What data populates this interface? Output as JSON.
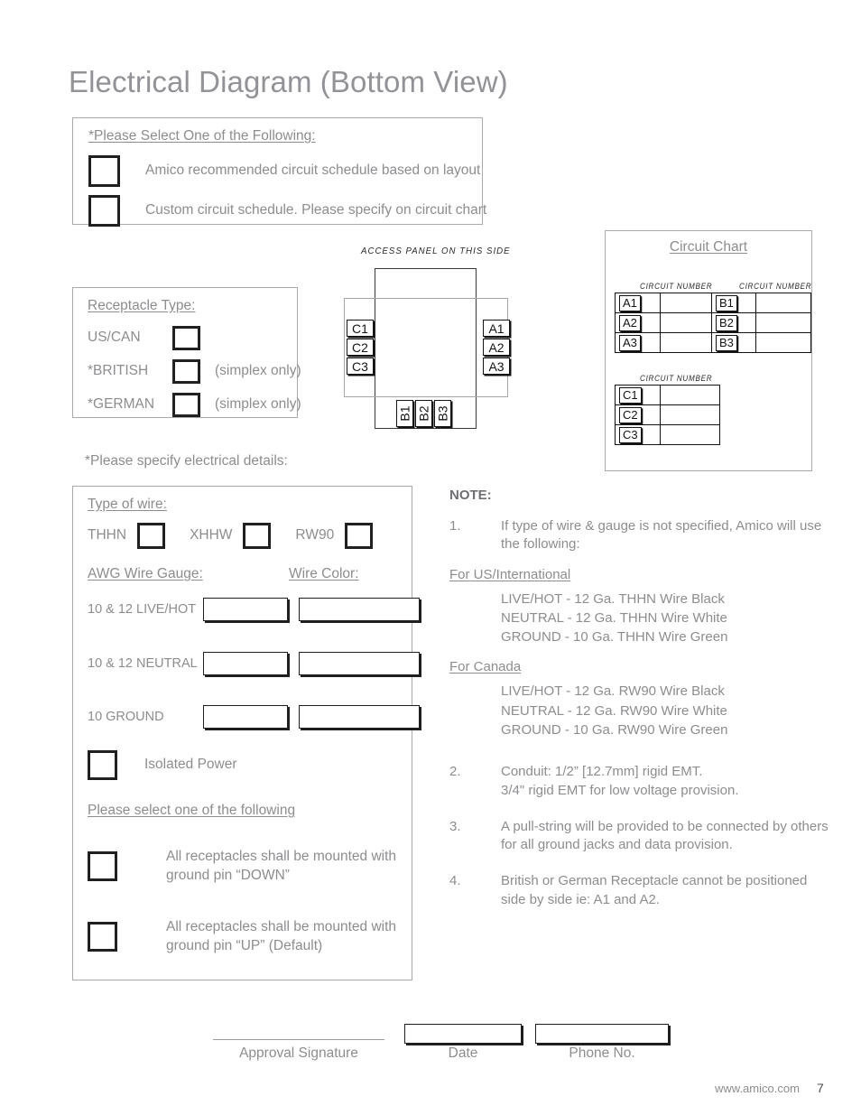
{
  "page_title": "Electrical Diagram (Bottom View)",
  "select_one": {
    "title": "*Please Select One of the Following:",
    "options": [
      "Amico recommended circuit schedule based on layout",
      "Custom circuit schedule. Please specify on circuit chart"
    ]
  },
  "receptacle": {
    "title": "Receptacle Type:",
    "rows": [
      {
        "name": "US/CAN",
        "note": ""
      },
      {
        "name": "*BRITISH",
        "note": "(simplex only)"
      },
      {
        "name": "*GERMAN",
        "note": "(simplex only)"
      }
    ]
  },
  "diagram": {
    "access_panel_label": "ACCESS PANEL ON THIS SIDE",
    "left_pins": [
      "C1",
      "C2",
      "C3"
    ],
    "right_pins": [
      "A1",
      "A2",
      "A3"
    ],
    "bottom_pins": [
      "B1",
      "B2",
      "B3"
    ]
  },
  "circuit_chart": {
    "title": "Circuit Chart",
    "column_header": "CIRCUIT NUMBER",
    "group_a": {
      "keys": [
        "A1",
        "A2",
        "A3"
      ],
      "values": [
        "",
        "",
        ""
      ]
    },
    "group_b": {
      "keys": [
        "B1",
        "B2",
        "B3"
      ],
      "values": [
        "",
        "",
        ""
      ]
    },
    "group_c": {
      "keys": [
        "C1",
        "C2",
        "C3"
      ],
      "values": [
        "",
        "",
        ""
      ]
    }
  },
  "specify_details": "*Please specify electrical details:",
  "wire": {
    "type_title": "Type of wire:",
    "types": [
      "THHN",
      "XHHW",
      "RW90"
    ],
    "awg_title": "AWG Wire Gauge:",
    "color_title": "Wire Color:",
    "gauge_rows": [
      {
        "label": "10 & 12 LIVE/HOT",
        "gauge": "",
        "color": ""
      },
      {
        "label": "10 & 12 NEUTRAL",
        "gauge": "",
        "color": ""
      },
      {
        "label": "10 GROUND",
        "gauge": "",
        "color": ""
      }
    ],
    "isolated_power": "Isolated Power",
    "select_following": "Please select one of the following",
    "ground_options": [
      "All receptacles shall be mounted with ground pin “DOWN”",
      "All receptacles shall be mounted with ground pin “UP” (Default)"
    ]
  },
  "notes": {
    "heading": "NOTE:",
    "item1_num": "1.",
    "item1_text": "If type of wire & gauge is not specified, Amico will use the following:",
    "us_heading": "For US/International",
    "us_lines": [
      "LIVE/HOT - 12 Ga. THHN Wire Black",
      "NEUTRAL - 12 Ga. THHN Wire White",
      "GROUND - 10 Ga. THHN Wire Green"
    ],
    "canada_heading": "For Canada",
    "canada_lines": [
      "LIVE/HOT - 12 Ga. RW90 Wire Black",
      "NEUTRAL - 12 Ga. RW90 Wire White",
      "GROUND - 10 Ga. RW90 Wire Green"
    ],
    "item2_num": "2.",
    "item2_text": "Conduit: 1/2” [12.7mm] rigid EMT.\n 3/4\" rigid EMT for low voltage provision.",
    "item3_num": "3.",
    "item3_text": "A pull-string will be provided to be connected by others for all ground jacks and data provision.",
    "item4_num": "4.",
    "item4_text": "British or German Receptacle cannot be positioned side by side ie: A1 and A2."
  },
  "footer": {
    "signature_label": "Approval Signature",
    "date_label": "Date",
    "date_value": "",
    "phone_label": "Phone No.",
    "phone_value": "",
    "url": "www.amico.com",
    "page_number": "7"
  }
}
